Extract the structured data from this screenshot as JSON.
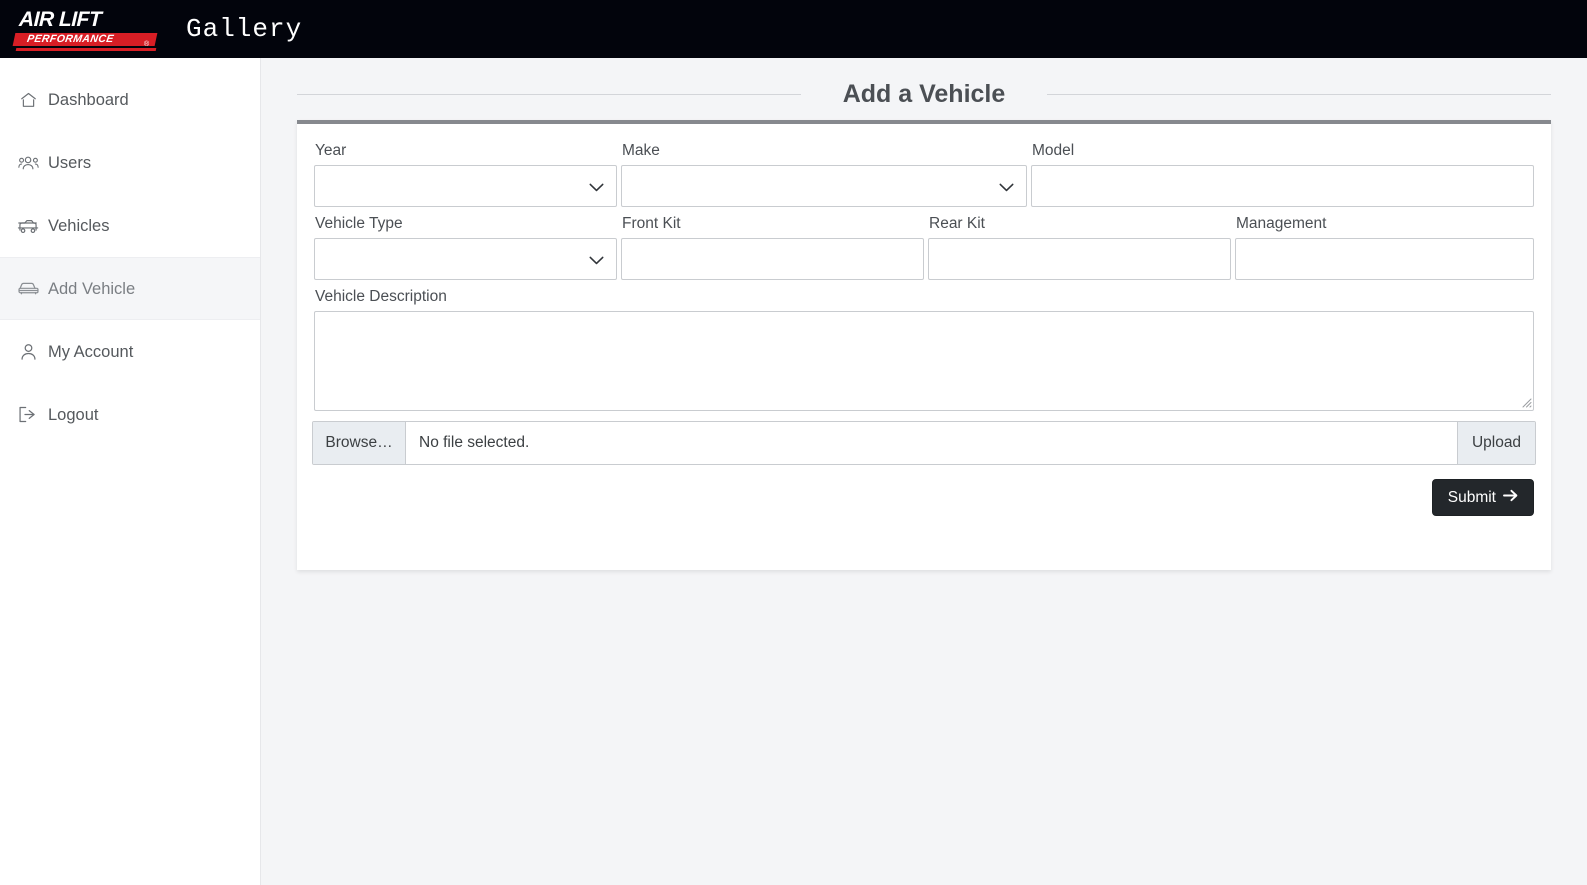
{
  "topbar": {
    "logo": {
      "line1": "AIR LIFT",
      "line2": "PERFORMANCE",
      "registered": "®",
      "icon_name": "air-lift-performance-logo"
    },
    "brand_title": "Gallery"
  },
  "sidebar": {
    "items": [
      {
        "label": "Dashboard",
        "icon": "home-icon",
        "active": false
      },
      {
        "label": "Users",
        "icon": "users-icon",
        "active": false
      },
      {
        "label": "Vehicles",
        "icon": "car-side-icon",
        "active": false
      },
      {
        "label": "Add Vehicle",
        "icon": "car-front-icon",
        "active": true
      },
      {
        "label": "My Account",
        "icon": "user-icon",
        "active": false
      },
      {
        "label": "Logout",
        "icon": "sign-out-icon",
        "active": false
      }
    ]
  },
  "main": {
    "page_title": "Add a Vehicle",
    "form": {
      "row1": [
        {
          "label": "Year",
          "type": "select",
          "value": "",
          "icon": "chevron-down-icon"
        },
        {
          "label": "Make",
          "type": "select",
          "value": "",
          "icon": "chevron-down-icon"
        },
        {
          "label": "Model",
          "type": "text",
          "value": "",
          "placeholder": ""
        }
      ],
      "row2": [
        {
          "label": "Vehicle Type",
          "type": "select",
          "value": "",
          "icon": "chevron-down-icon"
        },
        {
          "label": "Front Kit",
          "type": "text",
          "value": "",
          "placeholder": ""
        },
        {
          "label": "Rear Kit",
          "type": "text",
          "value": "",
          "placeholder": ""
        },
        {
          "label": "Management",
          "type": "text",
          "value": "",
          "placeholder": ""
        }
      ],
      "description": {
        "label": "Vehicle Description",
        "value": "",
        "placeholder": ""
      },
      "file": {
        "browse_label": "Browse…",
        "file_status": "No file selected.",
        "upload_label": "Upload"
      },
      "submit": {
        "label": "Submit",
        "icon": "arrow-right-icon"
      }
    }
  },
  "colors": {
    "topbar_bg": "#02040c",
    "logo_red": "#d81e25",
    "page_bg": "#f4f5f7",
    "card_bg": "#ffffff",
    "card_top_border": "#86898e",
    "sidebar_bg": "#ffffff",
    "sidebar_active_bg": "#f5f6f8",
    "submit_bg": "#23272b",
    "input_border": "#c9ccd0",
    "text": "#4b4f54"
  }
}
